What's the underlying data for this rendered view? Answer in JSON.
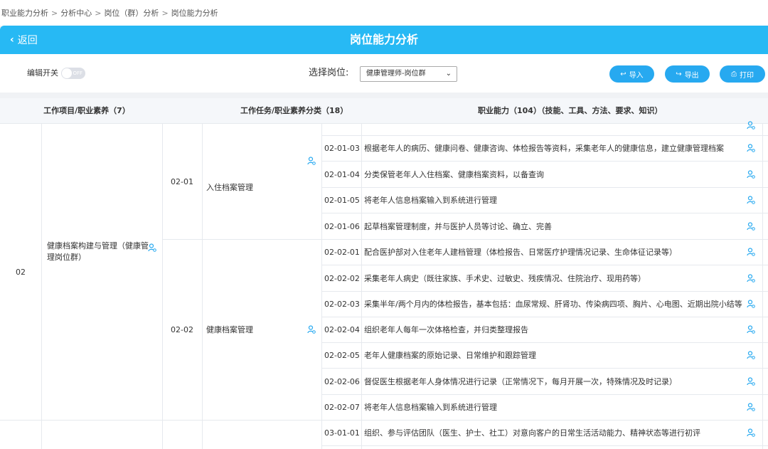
{
  "breadcrumb": [
    "职业能力分析",
    "分析中心",
    "岗位（群）分析",
    "岗位能力分析"
  ],
  "header": {
    "back_label": "返回",
    "title": "岗位能力分析"
  },
  "toolbar": {
    "edit_label": "编辑开关",
    "toggle_text": "OFF",
    "select_label": "选择岗位:",
    "select_value": "健康管理师-岗位群",
    "import_label": "导入",
    "export_label": "导出",
    "print_label": "打印"
  },
  "table": {
    "headers": {
      "project": "工作项目/职业素养（7）",
      "task": "工作任务/职业素养分类（18）",
      "ability": "职业能力（104）（技能、工具、方法、要求、知识）"
    },
    "project": {
      "code": "02",
      "name": "健康档案构建与管理（健康管理岗位群）"
    },
    "tasks": [
      {
        "code": "02-01",
        "name": "入住档案管理"
      },
      {
        "code": "02-02",
        "name": "健康档案管理"
      }
    ],
    "abilities": [
      {
        "code": "02-01-03",
        "desc": "根据老年人的病历、健康问卷、健康咨询、体检报告等资料，采集老年人的健康信息，建立健康管理档案"
      },
      {
        "code": "02-01-04",
        "desc": "分类保管老年人入住档案、健康档案资料，以备查询"
      },
      {
        "code": "02-01-05",
        "desc": "将老年人信息档案输入到系统进行管理"
      },
      {
        "code": "02-01-06",
        "desc": "起草档案管理制度，并与医护人员等讨论、确立、完善"
      },
      {
        "code": "02-02-01",
        "desc": "配合医护部对入住老年人建档管理（体检报告、日常医疗护理情况记录、生命体征记录等）"
      },
      {
        "code": "02-02-02",
        "desc": "采集老年人病史（既往家族、手术史、过敏史、残疾情况、住院治疗、现用药等）"
      },
      {
        "code": "02-02-03",
        "desc": "采集半年/两个月内的体检报告，基本包括：血尿常规、肝肾功、传染病四项、胸片、心电图、近期出院小结等"
      },
      {
        "code": "02-02-04",
        "desc": "组织老年人每年一次体格检查，并归类整理报告"
      },
      {
        "code": "02-02-05",
        "desc": "老年人健康档案的原始记录、日常维护和跟踪管理"
      },
      {
        "code": "02-02-06",
        "desc": "督促医生根据老年人身体情况进行记录（正常情况下，每月开展一次，特殊情况及时记录）"
      },
      {
        "code": "02-02-07",
        "desc": "将老年人信息档案输入到系统进行管理"
      },
      {
        "code": "03-01-01",
        "desc": "组织、参与评估团队（医生、护士、社工）对意向客户的日常生活活动能力、精神状态等进行初评"
      }
    ]
  },
  "colors": {
    "accent": "#27b9f4",
    "button": "#27a9f0"
  },
  "icons": {
    "edit_person": "user-edit-icon"
  }
}
